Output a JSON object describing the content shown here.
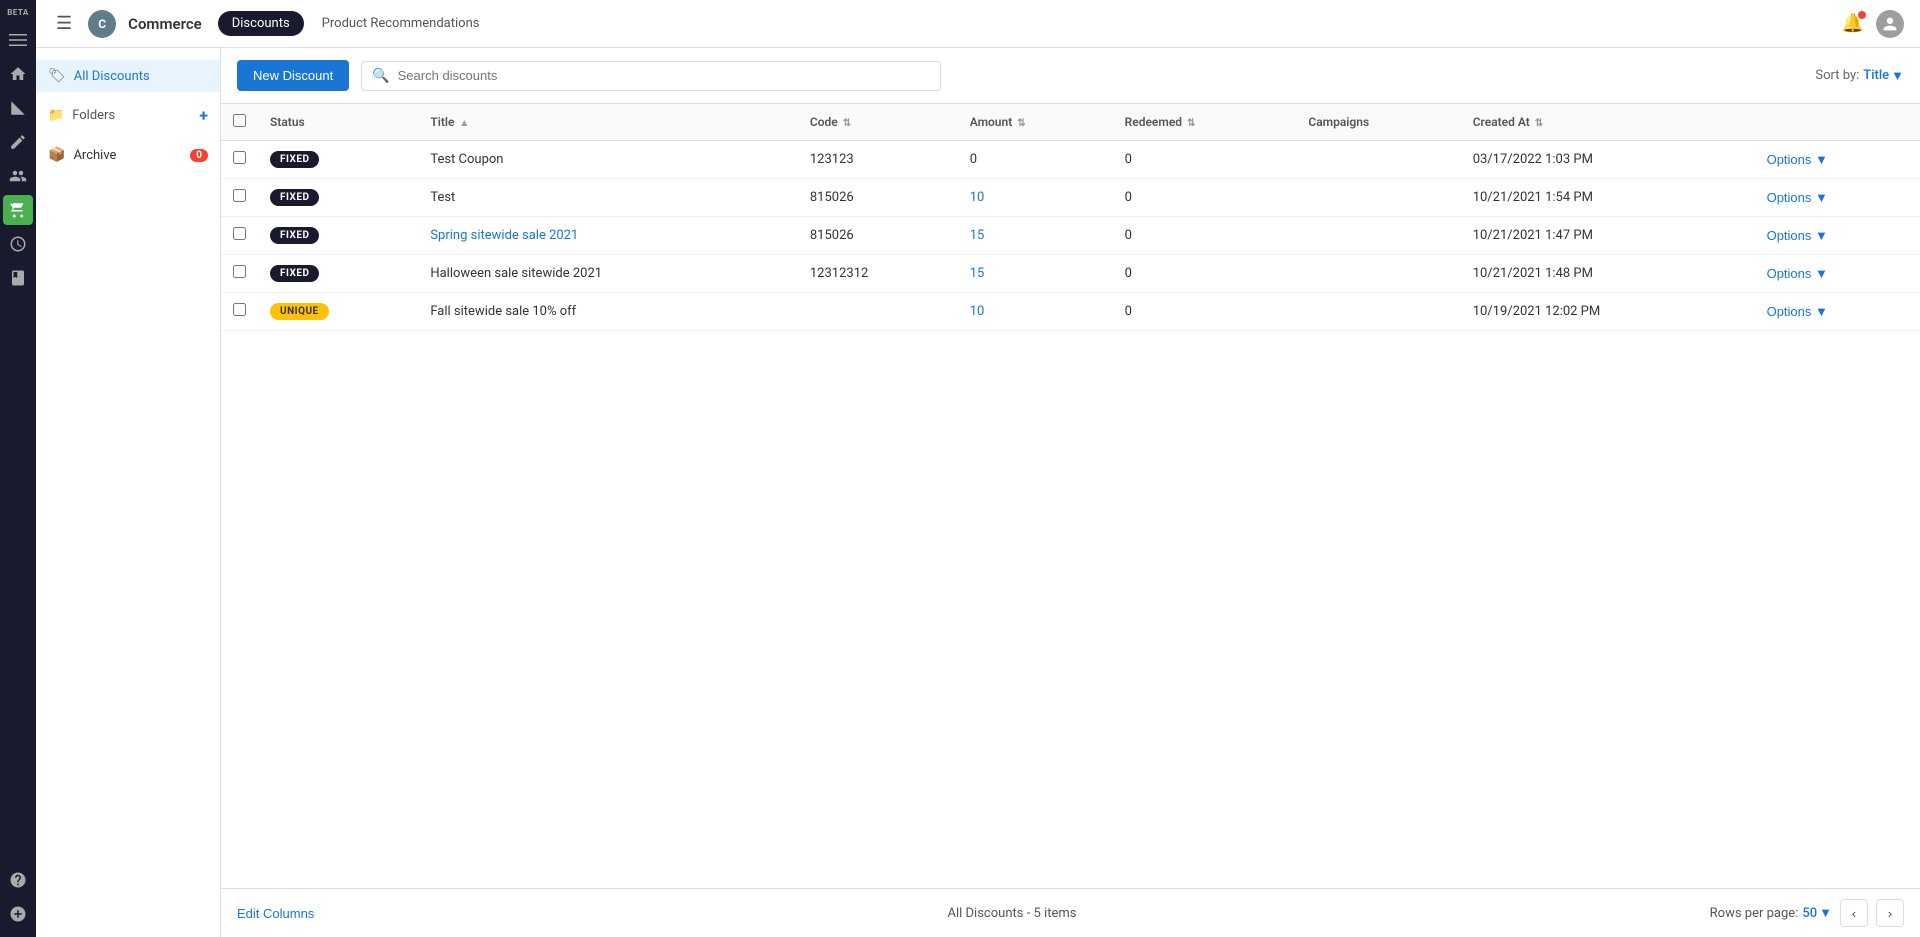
{
  "app": {
    "beta_label": "BETA",
    "brand_initial": "C",
    "brand_name": "Commerce",
    "nav_tabs": [
      {
        "id": "discounts",
        "label": "Discounts",
        "active": true
      },
      {
        "id": "product_recommendations",
        "label": "Product Recommendations",
        "active": false
      }
    ]
  },
  "header": {
    "hamburger_icon": "☰",
    "notification_icon": "🔔",
    "user_icon": "👤"
  },
  "sidebar": {
    "all_discounts_label": "All Discounts",
    "folders_label": "Folders",
    "add_folder_icon": "+",
    "archive_label": "Archive",
    "archive_badge": "0"
  },
  "toolbar": {
    "new_discount_label": "New Discount",
    "search_placeholder": "Search discounts",
    "sort_by_label": "Sort by:",
    "sort_value": "Title",
    "sort_arrow": "▼"
  },
  "table": {
    "columns": [
      {
        "id": "status",
        "label": "Status",
        "sortable": false
      },
      {
        "id": "title",
        "label": "Title",
        "sortable": true,
        "sort_dir": "▲"
      },
      {
        "id": "code",
        "label": "Code",
        "sortable": true
      },
      {
        "id": "amount",
        "label": "Amount",
        "sortable": true
      },
      {
        "id": "redeemed",
        "label": "Redeemed",
        "sortable": true
      },
      {
        "id": "campaigns",
        "label": "Campaigns",
        "sortable": false
      },
      {
        "id": "created_at",
        "label": "Created At",
        "sortable": true
      }
    ],
    "rows": [
      {
        "id": 1,
        "status": "FIXED",
        "status_type": "fixed",
        "title": "Test Coupon",
        "title_linked": false,
        "code": "123123",
        "amount": "0",
        "amount_linked": false,
        "redeemed": "0",
        "campaigns": "",
        "created_at": "03/17/2022 1:03 PM",
        "options_label": "Options"
      },
      {
        "id": 2,
        "status": "FIXED",
        "status_type": "fixed",
        "title": "Test",
        "title_linked": false,
        "code": "815026",
        "amount": "10",
        "amount_linked": true,
        "redeemed": "0",
        "campaigns": "",
        "created_at": "10/21/2021 1:54 PM",
        "options_label": "Options"
      },
      {
        "id": 3,
        "status": "FIXED",
        "status_type": "fixed",
        "title": "Spring sitewide sale 2021",
        "title_linked": true,
        "code": "815026",
        "amount": "15",
        "amount_linked": true,
        "redeemed": "0",
        "campaigns": "",
        "created_at": "10/21/2021 1:47 PM",
        "options_label": "Options"
      },
      {
        "id": 4,
        "status": "FIXED",
        "status_type": "fixed",
        "title": "Halloween sale sitewide 2021",
        "title_linked": false,
        "code": "12312312",
        "amount": "15",
        "amount_linked": true,
        "redeemed": "0",
        "campaigns": "",
        "created_at": "10/21/2021 1:48 PM",
        "options_label": "Options"
      },
      {
        "id": 5,
        "status": "UNIQUE",
        "status_type": "unique",
        "title": "Fall sitewide sale 10% off",
        "title_linked": false,
        "code": "",
        "amount": "10",
        "amount_linked": true,
        "redeemed": "0",
        "campaigns": "",
        "created_at": "10/19/2021 12:02 PM",
        "options_label": "Options"
      }
    ]
  },
  "footer": {
    "edit_columns_label": "Edit Columns",
    "summary_label": "All Discounts",
    "summary_count": "5 items",
    "rows_per_page_label": "Rows per page:",
    "rows_per_page_value": "50",
    "rows_arrow": "▼"
  }
}
